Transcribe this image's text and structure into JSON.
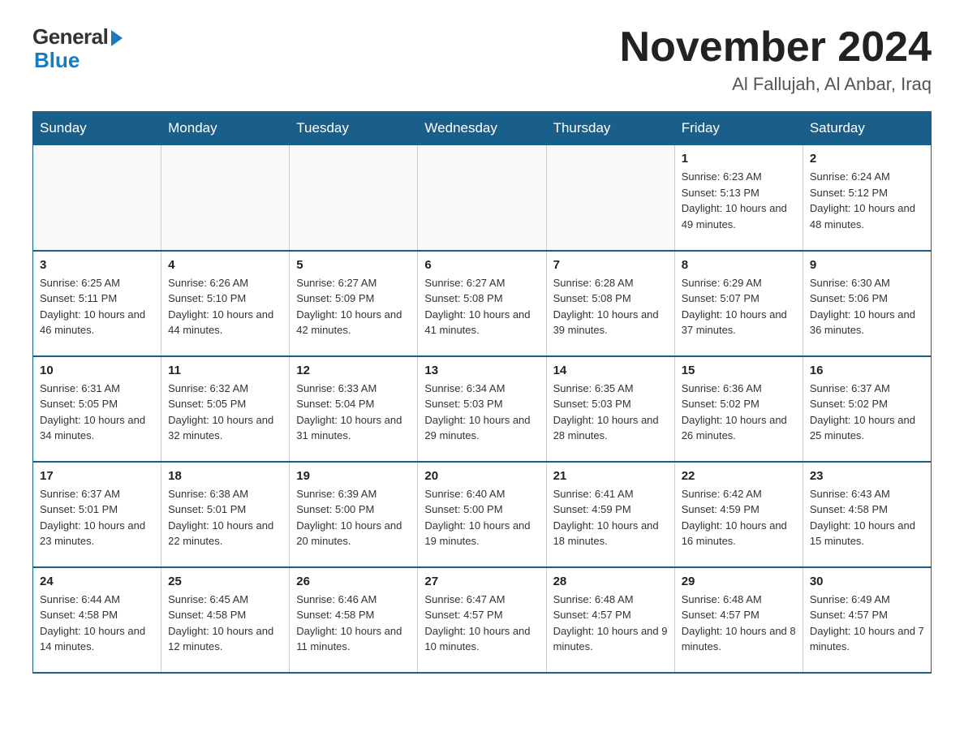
{
  "header": {
    "logo_general": "General",
    "logo_blue": "Blue",
    "month_title": "November 2024",
    "location": "Al Fallujah, Al Anbar, Iraq"
  },
  "days_of_week": [
    "Sunday",
    "Monday",
    "Tuesday",
    "Wednesday",
    "Thursday",
    "Friday",
    "Saturday"
  ],
  "weeks": [
    [
      {
        "day": "",
        "info": ""
      },
      {
        "day": "",
        "info": ""
      },
      {
        "day": "",
        "info": ""
      },
      {
        "day": "",
        "info": ""
      },
      {
        "day": "",
        "info": ""
      },
      {
        "day": "1",
        "info": "Sunrise: 6:23 AM\nSunset: 5:13 PM\nDaylight: 10 hours and 49 minutes."
      },
      {
        "day": "2",
        "info": "Sunrise: 6:24 AM\nSunset: 5:12 PM\nDaylight: 10 hours and 48 minutes."
      }
    ],
    [
      {
        "day": "3",
        "info": "Sunrise: 6:25 AM\nSunset: 5:11 PM\nDaylight: 10 hours and 46 minutes."
      },
      {
        "day": "4",
        "info": "Sunrise: 6:26 AM\nSunset: 5:10 PM\nDaylight: 10 hours and 44 minutes."
      },
      {
        "day": "5",
        "info": "Sunrise: 6:27 AM\nSunset: 5:09 PM\nDaylight: 10 hours and 42 minutes."
      },
      {
        "day": "6",
        "info": "Sunrise: 6:27 AM\nSunset: 5:08 PM\nDaylight: 10 hours and 41 minutes."
      },
      {
        "day": "7",
        "info": "Sunrise: 6:28 AM\nSunset: 5:08 PM\nDaylight: 10 hours and 39 minutes."
      },
      {
        "day": "8",
        "info": "Sunrise: 6:29 AM\nSunset: 5:07 PM\nDaylight: 10 hours and 37 minutes."
      },
      {
        "day": "9",
        "info": "Sunrise: 6:30 AM\nSunset: 5:06 PM\nDaylight: 10 hours and 36 minutes."
      }
    ],
    [
      {
        "day": "10",
        "info": "Sunrise: 6:31 AM\nSunset: 5:05 PM\nDaylight: 10 hours and 34 minutes."
      },
      {
        "day": "11",
        "info": "Sunrise: 6:32 AM\nSunset: 5:05 PM\nDaylight: 10 hours and 32 minutes."
      },
      {
        "day": "12",
        "info": "Sunrise: 6:33 AM\nSunset: 5:04 PM\nDaylight: 10 hours and 31 minutes."
      },
      {
        "day": "13",
        "info": "Sunrise: 6:34 AM\nSunset: 5:03 PM\nDaylight: 10 hours and 29 minutes."
      },
      {
        "day": "14",
        "info": "Sunrise: 6:35 AM\nSunset: 5:03 PM\nDaylight: 10 hours and 28 minutes."
      },
      {
        "day": "15",
        "info": "Sunrise: 6:36 AM\nSunset: 5:02 PM\nDaylight: 10 hours and 26 minutes."
      },
      {
        "day": "16",
        "info": "Sunrise: 6:37 AM\nSunset: 5:02 PM\nDaylight: 10 hours and 25 minutes."
      }
    ],
    [
      {
        "day": "17",
        "info": "Sunrise: 6:37 AM\nSunset: 5:01 PM\nDaylight: 10 hours and 23 minutes."
      },
      {
        "day": "18",
        "info": "Sunrise: 6:38 AM\nSunset: 5:01 PM\nDaylight: 10 hours and 22 minutes."
      },
      {
        "day": "19",
        "info": "Sunrise: 6:39 AM\nSunset: 5:00 PM\nDaylight: 10 hours and 20 minutes."
      },
      {
        "day": "20",
        "info": "Sunrise: 6:40 AM\nSunset: 5:00 PM\nDaylight: 10 hours and 19 minutes."
      },
      {
        "day": "21",
        "info": "Sunrise: 6:41 AM\nSunset: 4:59 PM\nDaylight: 10 hours and 18 minutes."
      },
      {
        "day": "22",
        "info": "Sunrise: 6:42 AM\nSunset: 4:59 PM\nDaylight: 10 hours and 16 minutes."
      },
      {
        "day": "23",
        "info": "Sunrise: 6:43 AM\nSunset: 4:58 PM\nDaylight: 10 hours and 15 minutes."
      }
    ],
    [
      {
        "day": "24",
        "info": "Sunrise: 6:44 AM\nSunset: 4:58 PM\nDaylight: 10 hours and 14 minutes."
      },
      {
        "day": "25",
        "info": "Sunrise: 6:45 AM\nSunset: 4:58 PM\nDaylight: 10 hours and 12 minutes."
      },
      {
        "day": "26",
        "info": "Sunrise: 6:46 AM\nSunset: 4:58 PM\nDaylight: 10 hours and 11 minutes."
      },
      {
        "day": "27",
        "info": "Sunrise: 6:47 AM\nSunset: 4:57 PM\nDaylight: 10 hours and 10 minutes."
      },
      {
        "day": "28",
        "info": "Sunrise: 6:48 AM\nSunset: 4:57 PM\nDaylight: 10 hours and 9 minutes."
      },
      {
        "day": "29",
        "info": "Sunrise: 6:48 AM\nSunset: 4:57 PM\nDaylight: 10 hours and 8 minutes."
      },
      {
        "day": "30",
        "info": "Sunrise: 6:49 AM\nSunset: 4:57 PM\nDaylight: 10 hours and 7 minutes."
      }
    ]
  ]
}
